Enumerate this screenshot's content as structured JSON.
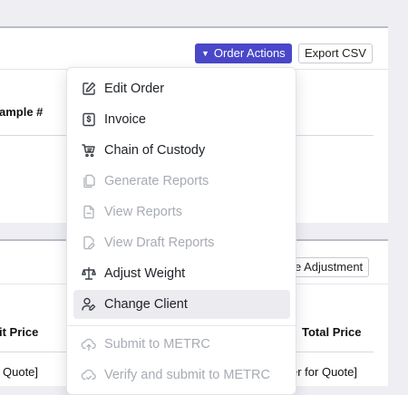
{
  "toolbar": {
    "order_actions_label": "Order Actions",
    "export_csv_label": "Export CSV"
  },
  "samples_table": {
    "column_sample": "ample #"
  },
  "pricing": {
    "adjustment_button": "e Adjustment",
    "column_unit_price": "it Price",
    "column_total_price": "Total Price",
    "row_unit_price": "Quote]",
    "row_total_price": "er for Quote]"
  },
  "menu": {
    "items": [
      {
        "label": "Edit Order",
        "icon": "pencil-square-icon",
        "disabled": false
      },
      {
        "label": "Invoice",
        "icon": "invoice-dollar-icon",
        "disabled": false
      },
      {
        "label": "Chain of Custody",
        "icon": "cart-chain-icon",
        "disabled": false
      },
      {
        "label": "Generate Reports",
        "icon": "documents-icon",
        "disabled": true
      },
      {
        "label": "View Reports",
        "icon": "file-icon",
        "disabled": true
      },
      {
        "label": "View Draft Reports",
        "icon": "file-edit-icon",
        "disabled": true
      },
      {
        "label": "Adjust Weight",
        "icon": "scale-icon",
        "disabled": false
      },
      {
        "label": "Change Client",
        "icon": "user-edit-icon",
        "disabled": false,
        "highlighted": true
      },
      {
        "label": "Submit to METRC",
        "icon": "cloud-upload-icon",
        "disabled": true
      },
      {
        "label": "Verify and submit to METRC",
        "icon": "cloud-check-icon",
        "disabled": true
      }
    ]
  },
  "colors": {
    "primary": "#4a47c9",
    "disabled_text": "#a7abb3",
    "highlight": "#ececf0"
  }
}
